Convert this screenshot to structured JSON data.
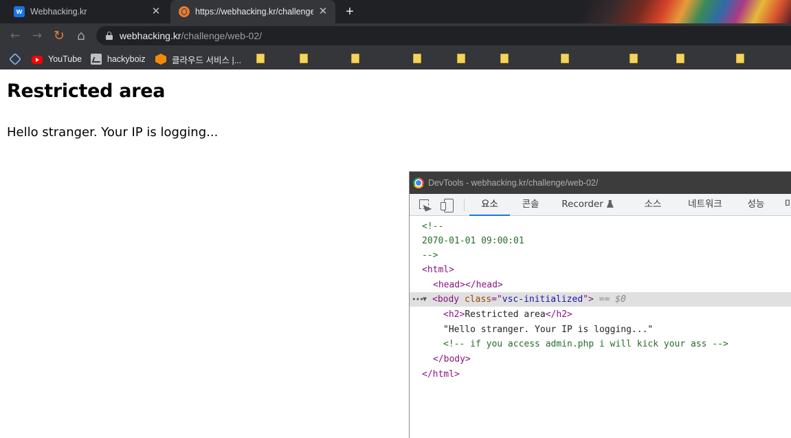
{
  "browser": {
    "tabs": [
      {
        "title": "Webhacking.kr",
        "favicon": "w-logo-icon",
        "active": false
      },
      {
        "title": "https://webhacking.kr/challenge",
        "favicon": "globe-icon",
        "active": true
      }
    ],
    "close_glyph": "✕",
    "new_tab_glyph": "+",
    "url": {
      "host": "webhacking.kr",
      "path": "/challenge/web-02/"
    },
    "nav_glyphs": {
      "back": "←",
      "forward": "→",
      "reload": "↻",
      "home": "⌂"
    }
  },
  "bookmarks": [
    {
      "label": "",
      "icon": "apps-icon"
    },
    {
      "label": "YouTube",
      "icon": "youtube-icon"
    },
    {
      "label": "hackyboiz",
      "icon": "hackyboiz-icon"
    },
    {
      "label": "클라우드 서비스 |...",
      "icon": "cloud-service-icon"
    }
  ],
  "page": {
    "title": "Restricted area",
    "text": "Hello stranger. Your IP is logging..."
  },
  "devtools": {
    "title": "DevTools - webhacking.kr/challenge/web-02/",
    "tabs": [
      "요소",
      "콘솔",
      "Recorder",
      "소스",
      "네트워크",
      "성능",
      "미"
    ],
    "active_tab": "요소",
    "code": {
      "comment_open": "<!--",
      "comment_date": "2070-01-01 09:00:01",
      "comment_close": "-->",
      "html_open": "<html>",
      "head_open": "<head>",
      "head_close": "</head>",
      "body_tag_open": "<body",
      "body_attr_name": "class",
      "body_attr_eq": "=\"",
      "body_attr_value": "vsc-initialized",
      "body_attr_end": "\">",
      "selected_marker": " == $0",
      "h2_open": "<h2>",
      "h2_text": "Restricted area",
      "h2_close": "</h2>",
      "text_node": "\"Hello stranger. Your IP is logging...\"",
      "hidden_comment": "<!-- if you access admin.php i will kick your ass -->",
      "body_close": "</body>",
      "html_close": "</html>",
      "dots": "•••",
      "triangle": "▼"
    }
  },
  "colors": {
    "tag": "#881280",
    "attr": "#994500",
    "value": "#1a1aa6",
    "comment": "#236e25",
    "active_tab_underline": "#1a73e8"
  }
}
